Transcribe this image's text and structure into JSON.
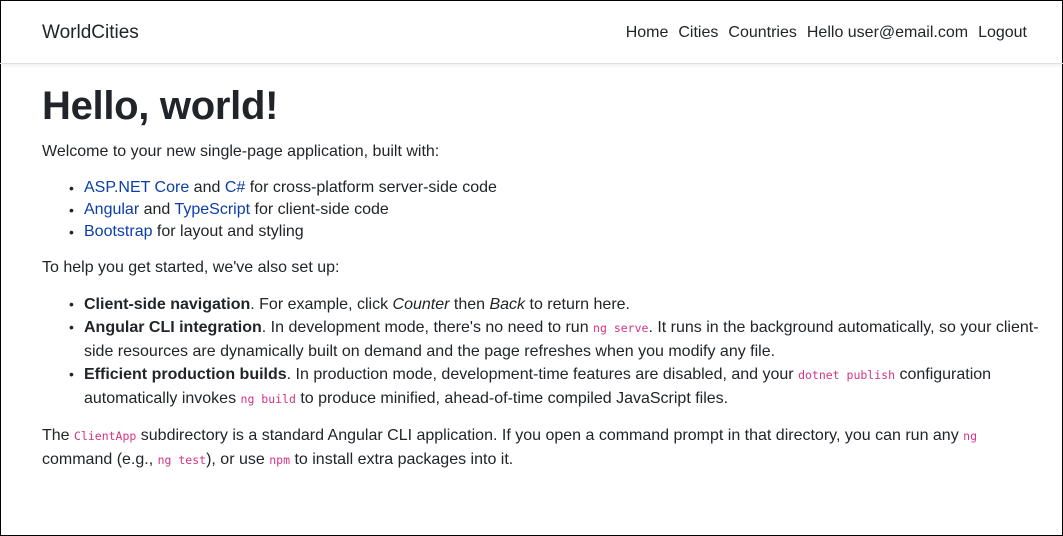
{
  "nav": {
    "brand": "WorldCities",
    "items": [
      "Home",
      "Cities",
      "Countries",
      "Hello user@email.com",
      "Logout"
    ]
  },
  "heading": "Hello, world!",
  "intro": "Welcome to your new single-page application, built with:",
  "built_with": [
    {
      "link1": "ASP.NET Core",
      "mid": " and ",
      "link2": "C#",
      "rest": " for cross-platform server-side code"
    },
    {
      "link1": "Angular",
      "mid": " and ",
      "link2": "TypeScript",
      "rest": " for client-side code"
    },
    {
      "link1": "Bootstrap",
      "rest": " for layout and styling"
    }
  ],
  "setup_intro": "To help you get started, we've also set up:",
  "features": [
    {
      "title": "Client-side navigation",
      "t1": ". For example, click ",
      "em1": "Counter",
      "t2": " then ",
      "em2": "Back",
      "t3": " to return here."
    },
    {
      "title": "Angular CLI integration",
      "t1": ". In development mode, there's no need to run ",
      "code1": "ng serve",
      "t2": ". It runs in the background automatically, so your client-side resources are dynamically built on demand and the page refreshes when you modify any file."
    },
    {
      "title": "Efficient production builds",
      "t1": ". In production mode, development-time features are disabled, and your ",
      "code1": "dotnet publish",
      "t2": " configuration automatically invokes ",
      "code2": "ng build",
      "t3": " to produce minified, ahead-of-time compiled JavaScript files."
    }
  ],
  "footer_para": {
    "t1": "The ",
    "code1": "ClientApp",
    "t2": " subdirectory is a standard Angular CLI application. If you open a command prompt in that directory, you can run any ",
    "code2": "ng",
    "t3": " command (e.g., ",
    "code3": "ng test",
    "t4": "), or use ",
    "code4": "npm",
    "t5": " to install extra packages into it."
  },
  "colors": {
    "link": "#0b3ea8",
    "code": "#d63384",
    "text": "#212529"
  }
}
